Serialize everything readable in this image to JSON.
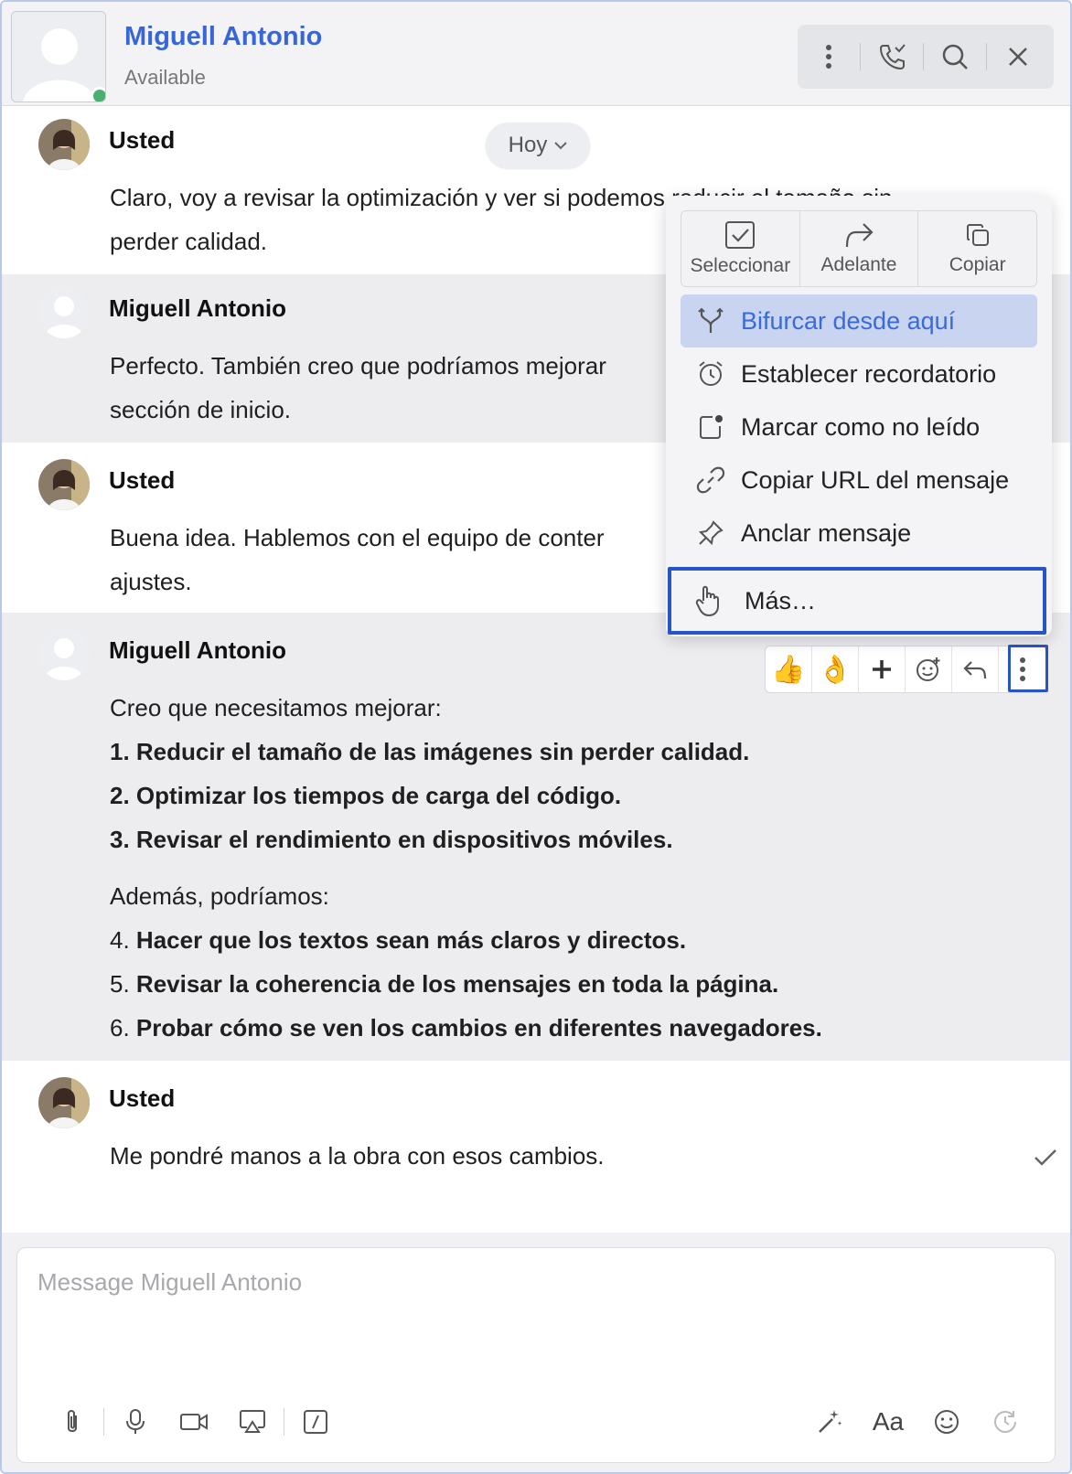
{
  "header": {
    "name": "Miguell Antonio",
    "status": "Available"
  },
  "date_pill": "Hoy",
  "messages": [
    {
      "author": "Usted",
      "lines": [
        "Claro, voy a revisar la optimización y ver si podemos reducir el tamaño sin",
        "perder calidad."
      ]
    },
    {
      "author": "Miguell Antonio",
      "lines": [
        "Perfecto. También creo que podríamos mejorar",
        "sección de inicio."
      ]
    },
    {
      "author": "Usted",
      "lines": [
        "Buena idea. Hablemos con el equipo de conter",
        "ajustes."
      ]
    },
    {
      "author": "Miguell Antonio",
      "intro": "Creo que necesitamos mejorar:",
      "list1": [
        "1. Reducir el tamaño de las imágenes sin perder calidad.",
        "2. Optimizar los tiempos de carga del código.",
        "3. Revisar el rendimiento en dispositivos móviles."
      ],
      "intro2": "Además, podríamos:",
      "list2": [
        {
          "num": "4.",
          "text": "Hacer que los textos sean más claros y directos."
        },
        {
          "num": "5.",
          "text": "Revisar la coherencia de los mensajes en toda la página."
        },
        {
          "num": "6.",
          "text": "Probar cómo se ven los cambios en diferentes navegadores."
        }
      ]
    },
    {
      "author": "Usted",
      "lines": [
        "Me pondré manos a la obra con esos cambios."
      ]
    }
  ],
  "context_menu": {
    "top": [
      "Seleccionar",
      "Adelante",
      "Copiar"
    ],
    "items": [
      {
        "label": "Bifurcar desde aquí",
        "icon": "fork-icon"
      },
      {
        "label": "Establecer recordatorio",
        "icon": "alarm-icon"
      },
      {
        "label": "Marcar como no leído",
        "icon": "unread-icon"
      },
      {
        "label": "Copiar URL del mensaje",
        "icon": "link-icon"
      },
      {
        "label": "Anclar mensaje",
        "icon": "pin-icon"
      },
      {
        "label": "Más…",
        "icon": "hand-pointer-icon"
      }
    ]
  },
  "reactions": [
    "👍",
    "👌"
  ],
  "composer": {
    "placeholder": "Message Miguell Antonio",
    "format_label": "Aa"
  },
  "colors": {
    "accent": "#3766d6",
    "highlight_outline": "#2854c5",
    "active_menu_bg": "#c8d4f0",
    "presence": "#4caf72"
  }
}
